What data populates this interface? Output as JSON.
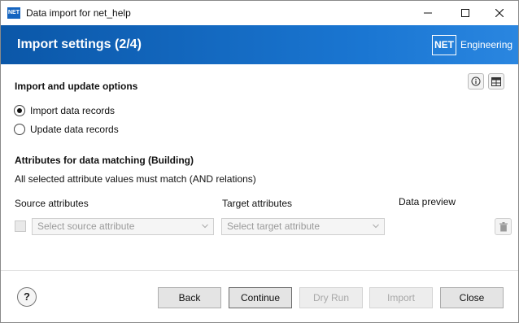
{
  "window": {
    "icon_text": "NET",
    "title": "Data import for net_help"
  },
  "banner": {
    "title": "Import settings (2/4)",
    "logo_mark": "NET",
    "logo_text": "Engineering"
  },
  "import_options": {
    "heading": "Import and update options",
    "options": [
      {
        "label": "Import data records",
        "selected": true
      },
      {
        "label": "Update data records",
        "selected": false
      }
    ]
  },
  "matching": {
    "heading": "Attributes for data matching (Building)",
    "description": "All selected attribute values must match (AND relations)",
    "source_header": "Source attributes",
    "target_header": "Target attributes",
    "preview_header": "Data preview",
    "source_placeholder": "Select source attribute",
    "target_placeholder": "Select target attribute"
  },
  "footer": {
    "help_label": "?",
    "buttons": {
      "back": "Back",
      "continue": "Continue",
      "dry_run": "Dry Run",
      "import": "Import",
      "close": "Close"
    }
  }
}
